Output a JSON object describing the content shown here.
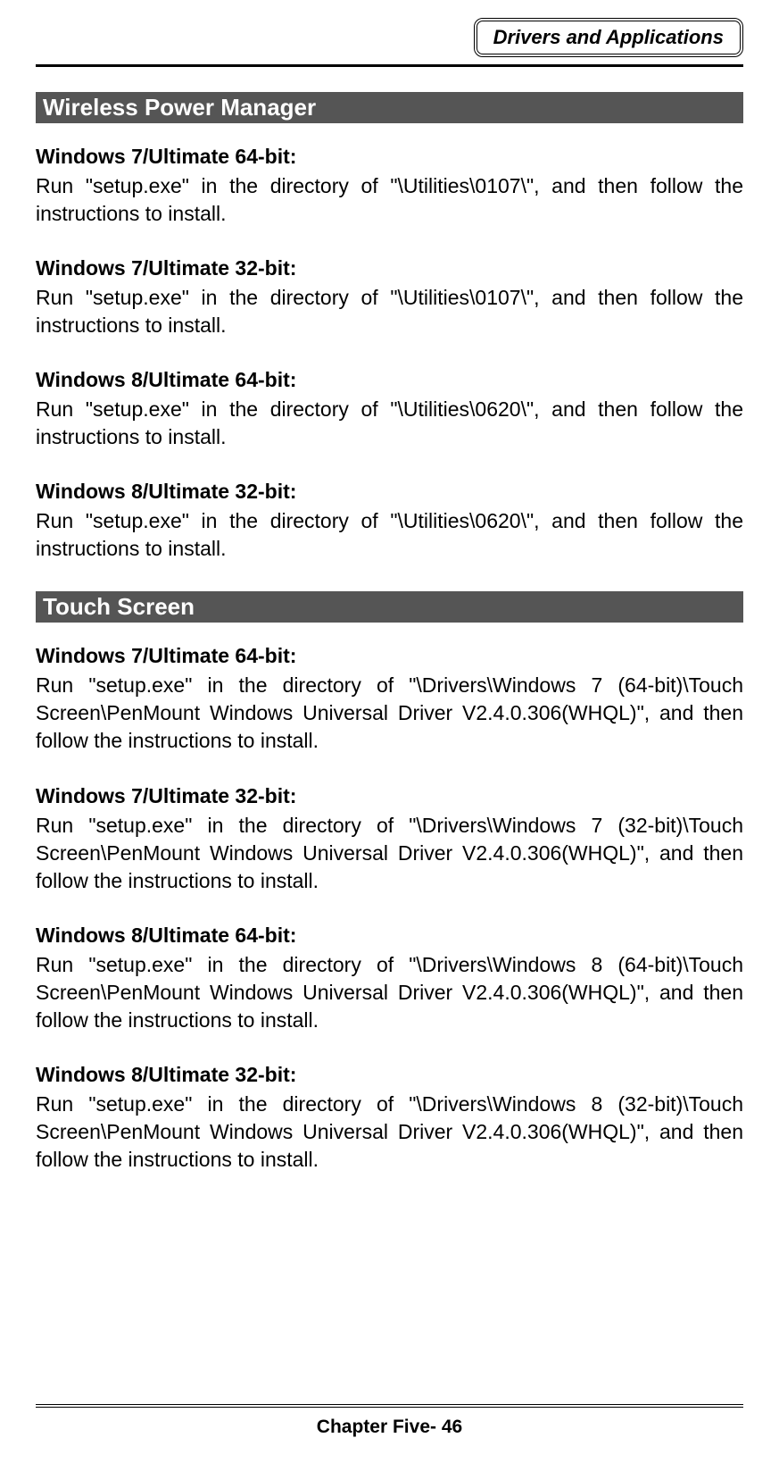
{
  "header": {
    "title": "Drivers and Applications"
  },
  "section1": {
    "title": " Wireless Power Manager",
    "items": [
      {
        "title": "Windows 7/Ultimate 64-bit:",
        "body": "Run \"setup.exe\" in the directory of \"\\Utilities\\0107\\\", and then follow the instructions to install."
      },
      {
        "title": "Windows 7/Ultimate 32-bit:",
        "body": "Run \"setup.exe\" in the directory of \"\\Utilities\\0107\\\", and then follow the instructions to install."
      },
      {
        "title": "Windows 8/Ultimate 64-bit:",
        "body": "Run \"setup.exe\" in the directory of \"\\Utilities\\0620\\\", and then follow the instructions to install."
      },
      {
        "title": "Windows 8/Ultimate 32-bit:",
        "body": "Run \"setup.exe\" in the directory of \"\\Utilities\\0620\\\", and then follow the instructions to install."
      }
    ]
  },
  "section2": {
    "title": " Touch Screen",
    "items": [
      {
        "title": "Windows 7/Ultimate 64-bit:",
        "body": "Run \"setup.exe\" in the directory of \"\\Drivers\\Windows 7 (64-bit)\\Touch Screen\\PenMount Windows Universal Driver V2.4.0.306(WHQL)\", and then follow the instructions to install."
      },
      {
        "title": "Windows 7/Ultimate 32-bit:",
        "body": "Run \"setup.exe\" in the directory of \"\\Drivers\\Windows 7 (32-bit)\\Touch Screen\\PenMount Windows Universal Driver V2.4.0.306(WHQL)\", and then follow the instructions to install."
      },
      {
        "title": "Windows 8/Ultimate 64-bit:",
        "body": "Run \"setup.exe\" in the directory of \"\\Drivers\\Windows 8 (64-bit)\\Touch Screen\\PenMount Windows Universal Driver V2.4.0.306(WHQL)\", and then follow the instructions to install."
      },
      {
        "title": "Windows 8/Ultimate 32-bit:",
        "body": "Run \"setup.exe\" in the directory of \"\\Drivers\\Windows 8 (32-bit)\\Touch Screen\\PenMount Windows Universal Driver V2.4.0.306(WHQL)\", and then follow the instructions to install."
      }
    ]
  },
  "footer": {
    "text": "Chapter Five- 46"
  }
}
